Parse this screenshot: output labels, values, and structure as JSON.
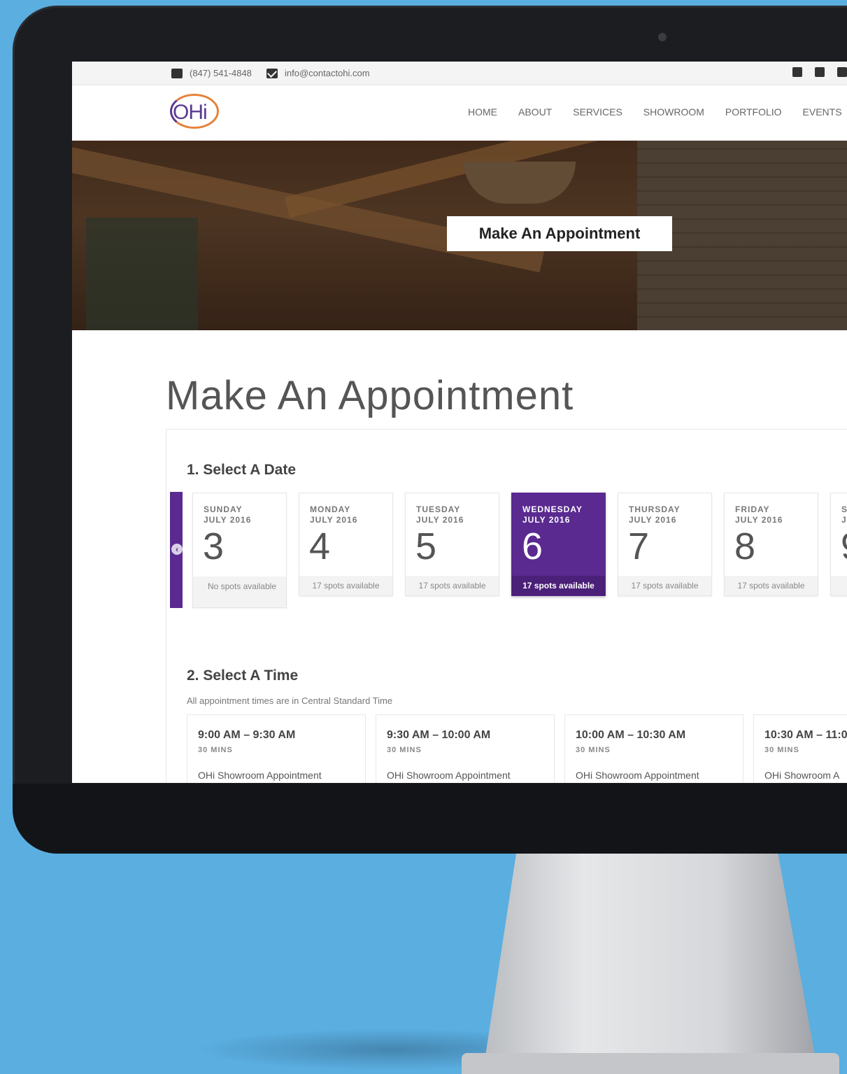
{
  "topbar": {
    "phone": "(847) 541-4848",
    "email": "info@contactohi.com",
    "social_icons": [
      "facebook-icon",
      "houzz-icon",
      "email-icon"
    ]
  },
  "header": {
    "logo_text": "OHi",
    "nav": [
      "HOME",
      "ABOUT",
      "SERVICES",
      "SHOWROOM",
      "PORTFOLIO",
      "EVENTS"
    ]
  },
  "hero": {
    "button_label": "Make An Appointment"
  },
  "main": {
    "title": "Make An Appointment",
    "date_section_title": "1. Select A Date",
    "time_section_title": "2. Select A Time",
    "time_note": "All appointment times are in Central Standard Time"
  },
  "dates": [
    {
      "day": "SUNDAY",
      "month": "JULY 2016",
      "num": "3",
      "avail": "No spots available"
    },
    {
      "day": "MONDAY",
      "month": "JULY 2016",
      "num": "4",
      "avail": "17 spots available"
    },
    {
      "day": "TUESDAY",
      "month": "JULY 2016",
      "num": "5",
      "avail": "17 spots available"
    },
    {
      "day": "WEDNESDAY",
      "month": "JULY 2016",
      "num": "6",
      "avail": "17 spots available"
    },
    {
      "day": "THURSDAY",
      "month": "JULY 2016",
      "num": "7",
      "avail": "17 spots available"
    },
    {
      "day": "FRIDAY",
      "month": "JULY 2016",
      "num": "8",
      "avail": "17 spots available"
    },
    {
      "day": "S",
      "month": "J",
      "num": "9",
      "avail": ""
    }
  ],
  "selected_date_index": 3,
  "slots": [
    {
      "time": "9:00 AM – 9:30 AM",
      "duration": "30 MINS",
      "name": "OHi Showroom Appointment"
    },
    {
      "time": "9:30 AM – 10:00 AM",
      "duration": "30 MINS",
      "name": "OHi Showroom Appointment"
    },
    {
      "time": "10:00 AM – 10:30 AM",
      "duration": "30 MINS",
      "name": "OHi Showroom Appointment"
    },
    {
      "time": "10:30 AM – 11:0",
      "duration": "30 MINS",
      "name": "OHi Showroom A"
    }
  ],
  "colors": {
    "accent": "#5a2a90",
    "accent_dark": "#4b2078",
    "background": "#5aaee0"
  }
}
